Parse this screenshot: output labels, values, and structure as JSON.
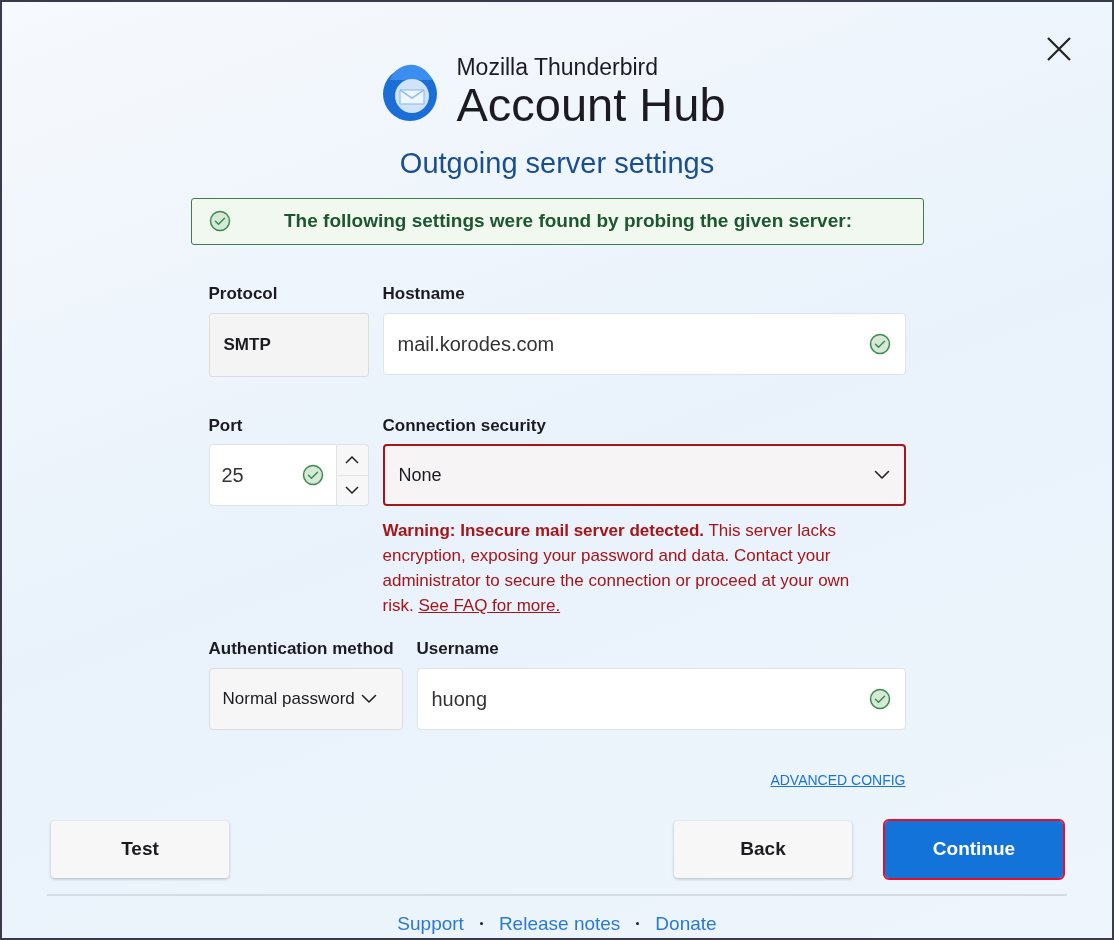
{
  "header": {
    "brand": "Mozilla Thunderbird",
    "product": "Account Hub",
    "title": "Outgoing server settings"
  },
  "banner": {
    "text": "The following settings were found by probing the given server:"
  },
  "protocol": {
    "label": "Protocol",
    "value": "SMTP"
  },
  "hostname": {
    "label": "Hostname",
    "value": "mail.korodes.com",
    "valid": true
  },
  "port": {
    "label": "Port",
    "value": "25",
    "valid": true
  },
  "security": {
    "label": "Connection security",
    "value": "None",
    "error": true
  },
  "warning": {
    "text": "**Warning: Insecure mail server detected.** This server lacks encryption, exposing your password and data. Contact your administrator to secure the connection or proceed at your own risk.",
    "link": "See FAQ for more."
  },
  "auth": {
    "label": "Authentication method",
    "value": "Normal password"
  },
  "username": {
    "label": "Username",
    "value": "huong",
    "valid": true
  },
  "advanced_link": "ADVANCED CONFIG",
  "buttons": [
    {
      "label": "Test",
      "kind": "secondary",
      "highlighted": false
    },
    {
      "label": "Back",
      "kind": "secondary",
      "highlighted": false
    },
    {
      "label": "Continue",
      "kind": "primary",
      "highlighted": true
    }
  ],
  "footer_links": [
    "Support",
    "Release notes",
    "Donate"
  ]
}
